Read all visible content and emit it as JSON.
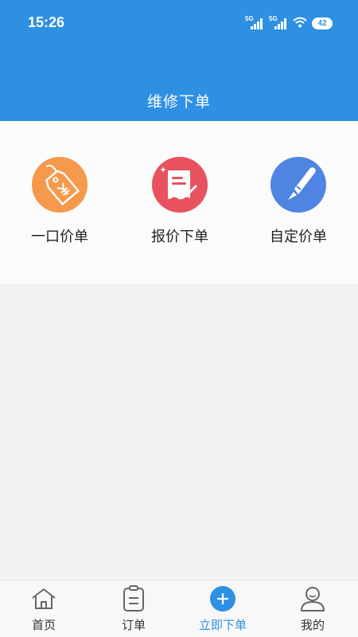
{
  "status_bar": {
    "time": "15:26",
    "network_1": "5G",
    "network_2": "5G",
    "battery": "42"
  },
  "header": {
    "title": "维修下单"
  },
  "options": [
    {
      "label": "一口价单",
      "icon": "price-tag-icon",
      "color": "#f59a4c"
    },
    {
      "label": "报价下单",
      "icon": "quote-document-icon",
      "color": "#e8525f"
    },
    {
      "label": "自定价单",
      "icon": "pencil-edit-icon",
      "color": "#4f84e3"
    }
  ],
  "tabbar": {
    "items": [
      {
        "label": "首页",
        "icon": "home-icon"
      },
      {
        "label": "订单",
        "icon": "order-list-icon"
      },
      {
        "label": "立即下单",
        "icon": "plus-circle-icon",
        "active": true
      },
      {
        "label": "我的",
        "icon": "user-icon"
      }
    ]
  },
  "colors": {
    "primary": "#2e90e2",
    "background": "#f2f2f2"
  }
}
